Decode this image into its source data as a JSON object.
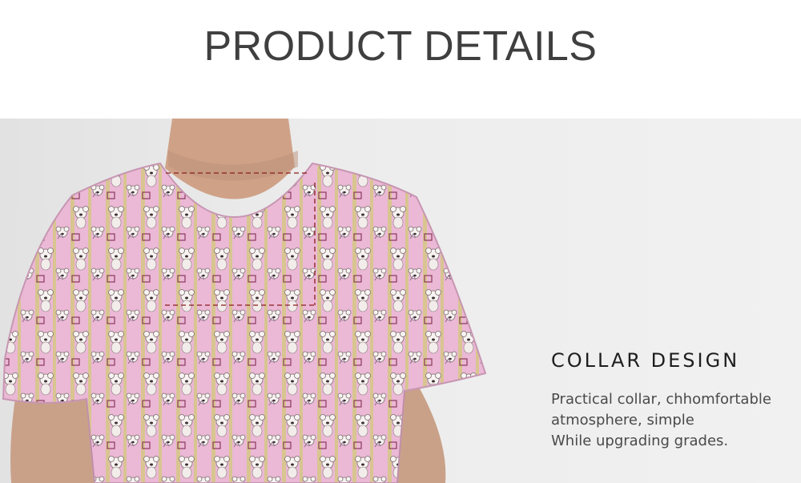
{
  "header": {
    "title": "PRODUCT DETAILS"
  },
  "feature": {
    "title": "COLLAR DESIGN",
    "lines": [
      "Practical collar, chhomfortable",
      "atmosphere, simple",
      "While upgrading grades."
    ]
  },
  "colors": {
    "title": "#3f3f3f",
    "background": "#ececec",
    "scrub_pink": "#e8b4d4",
    "stripe": "#d9c68e",
    "guide_line": "#8b1c1c"
  },
  "image": {
    "subject": "koala-print-scrub-top-photo"
  }
}
